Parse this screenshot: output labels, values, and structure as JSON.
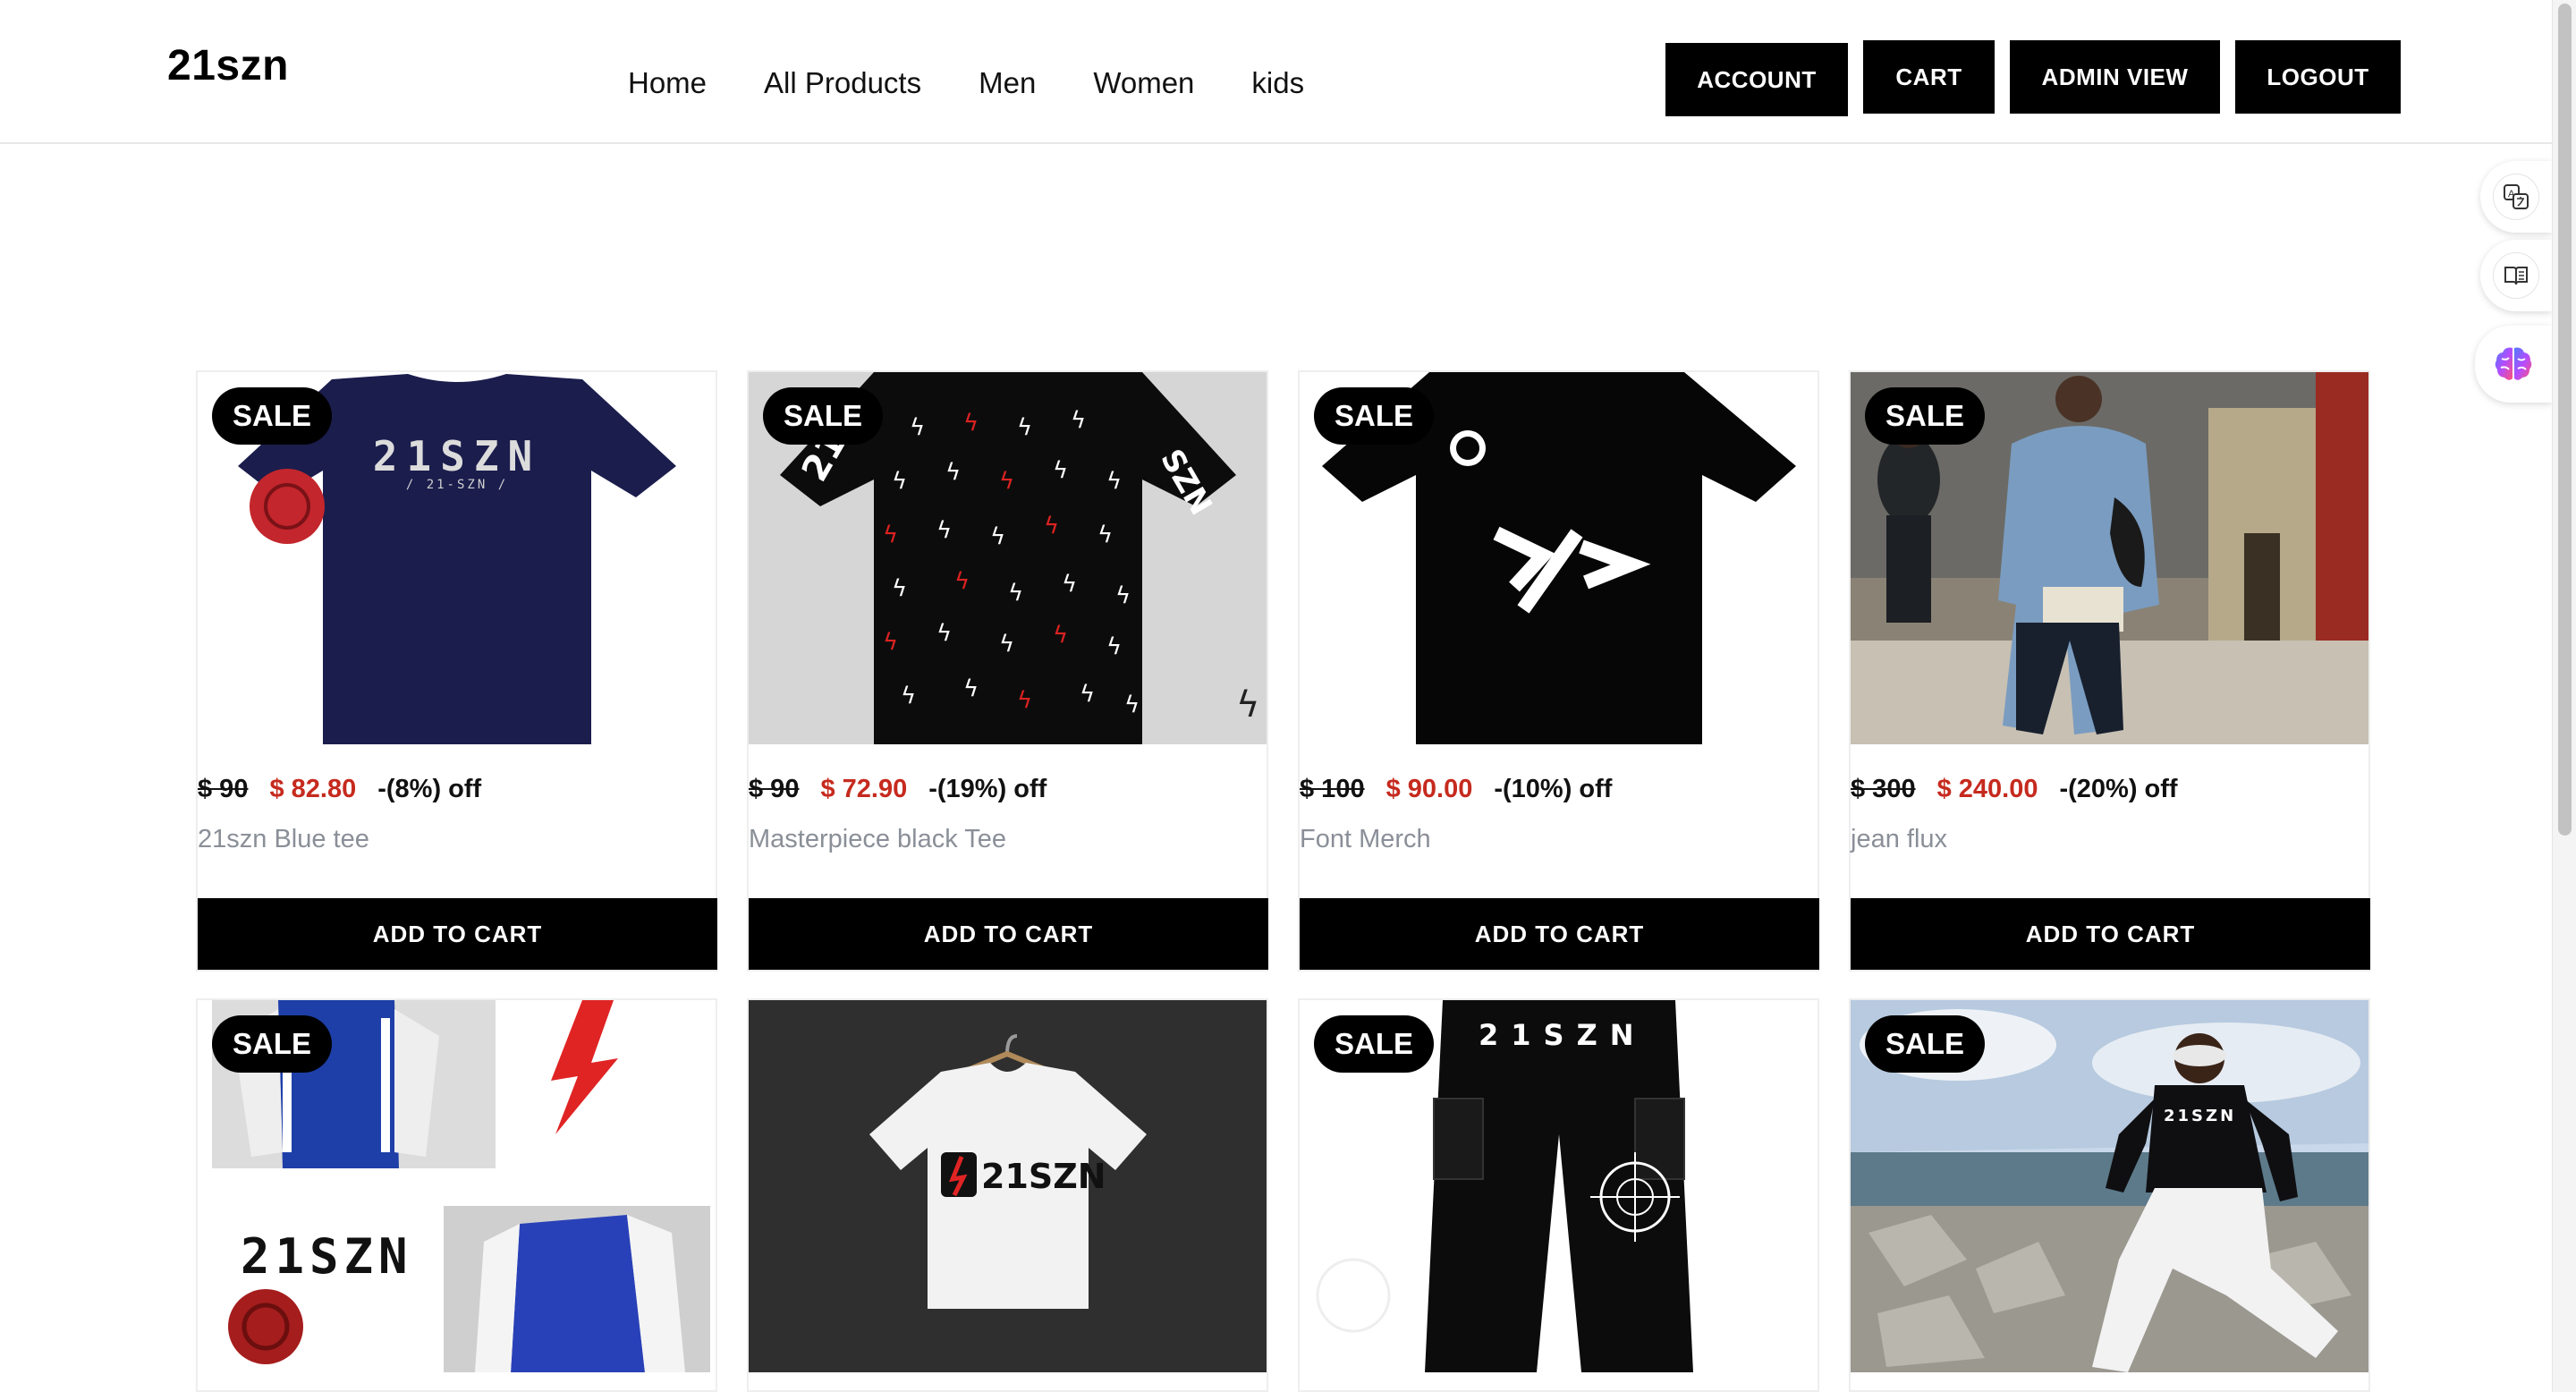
{
  "brand": "21szn",
  "nav": {
    "links": [
      "Home",
      "All Products",
      "Men",
      "Women",
      "kids"
    ],
    "buttons": {
      "account": "ACCOUNT",
      "cart": "CART",
      "admin": "ADMIN VIEW",
      "logout": "LOGOUT"
    }
  },
  "side_tools": [
    "translate-icon",
    "reader-icon",
    "brain-icon"
  ],
  "products": [
    {
      "badge": "SALE",
      "old_price": "$ 90",
      "new_price": "$ 82.80",
      "discount": "-(8%) off",
      "name": "21szn Blue tee",
      "cta": "ADD TO CART",
      "image": "navy-tshirt-image",
      "tee_text": "21SZN",
      "tee_sub": "/ 21-SZN /"
    },
    {
      "badge": "SALE",
      "old_price": "$ 90",
      "new_price": "$ 72.90",
      "discount": "-(19%) off",
      "name": "Masterpiece black Tee",
      "cta": "ADD TO CART",
      "image": "lightning-tshirt-image",
      "tee_text_left": "21",
      "tee_text_right": "SZN"
    },
    {
      "badge": "SALE",
      "old_price": "$ 100",
      "new_price": "$ 90.00",
      "discount": "-(10%) off",
      "name": "Font Merch",
      "cta": "ADD TO CART",
      "image": "code-tshirt-image"
    },
    {
      "badge": "SALE",
      "old_price": "$ 300",
      "new_price": "$ 240.00",
      "discount": "-(20%) off",
      "name": "jean flux",
      "cta": "ADD TO CART",
      "image": "denim-jacket-photo"
    },
    {
      "badge": "SALE",
      "image": "varsity-jacket-collage",
      "collage_text": "21SZN"
    },
    {
      "badge": "",
      "image": "white-tshirt-mockup",
      "tee_text": "21SZN"
    },
    {
      "badge": "SALE",
      "image": "cargo-pants-image",
      "pants_text": "21SZN"
    },
    {
      "badge": "SALE",
      "image": "hoodie-rocks-photo",
      "hoodie_text": "21SZN"
    }
  ],
  "colors": {
    "accent_sale_price": "#c62a1e",
    "button_bg": "#000000",
    "name_grey": "#8a8f98",
    "navy_tee": "#1a1c4a"
  }
}
